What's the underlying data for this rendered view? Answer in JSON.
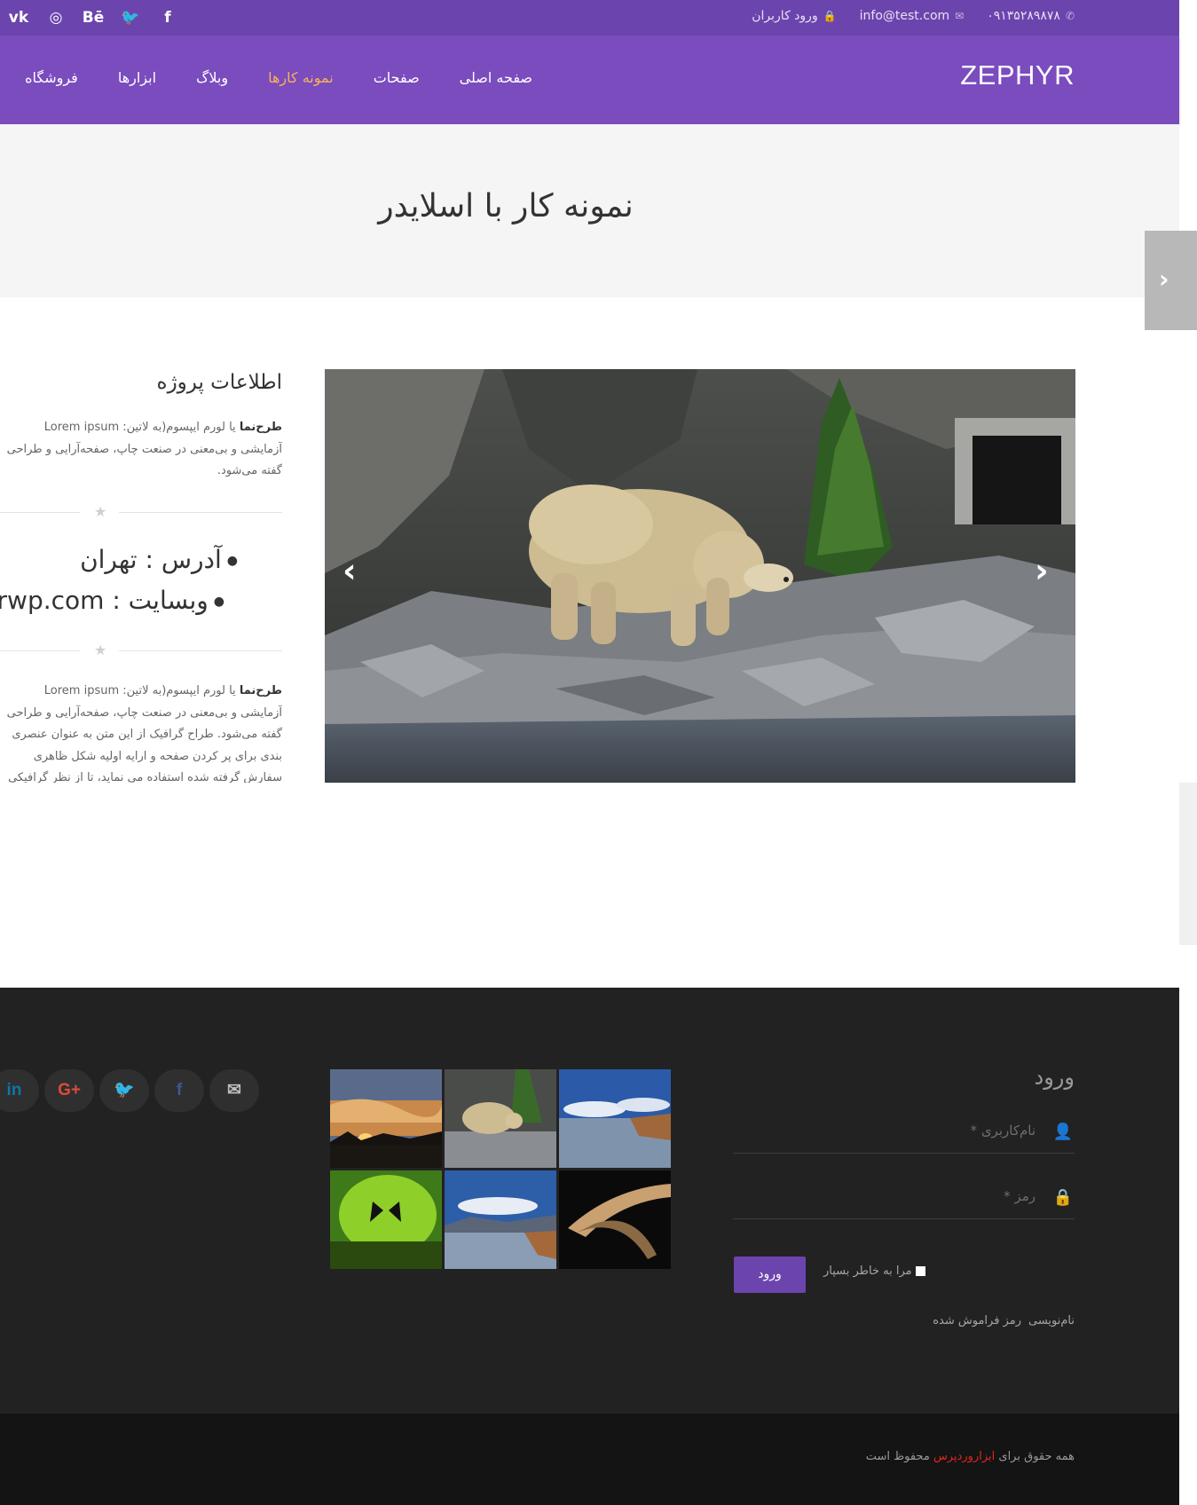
{
  "topbar": {
    "social": [
      "vk",
      "instagram",
      "behance",
      "twitter",
      "facebook"
    ],
    "social_glyphs": {
      "vk": "vk",
      "instagram": "◎",
      "behance": "Bē",
      "twitter": "🐦",
      "facebook": "f"
    },
    "phone": "۰۹۱۳۵۲۸۹۸۷۸",
    "email": "info@test.com",
    "login": "ورود کاربران"
  },
  "nav": {
    "brand": "ZEPHYR",
    "items": [
      "صفحه اصلی",
      "صفحات",
      "نمونه کارها",
      "وبلاگ",
      "ابزارها",
      "فروشگاه"
    ],
    "active_index": 2,
    "active_color": "#f7b35a"
  },
  "page": {
    "title": "نمونه کار با اسلایدر"
  },
  "project": {
    "heading": "اطلاعات پروژه",
    "intro_bold": "طرح‌نما",
    "intro_lines": [
      "یا لورم ایپسوم(به لاتین: Lorem ipsum",
      "آزمایشی و بی‌معنی در صنعت چاپ، صفحه‌آرایی و طراحی",
      "گفته می‌شود."
    ],
    "address": "آدرس : تهران",
    "website": "وبسایت : zarwp.com",
    "body_bold": "طرح‌نما",
    "body_lines": [
      "یا لورم ایپسوم(به لاتین: Lorem ipsum",
      "آزمایشی و بی‌معنی در صنعت چاپ، صفحه‌آرایی و طراحی",
      "گفته می‌شود. طراح گرافیک از این متن به عنوان عنصری",
      "بندی برای پر کردن صفحه و ارایه اولیه شکل ظاهری",
      "سفارش گرفته شده استفاده می نماید، تا از نظر گرافیکی"
    ]
  },
  "login": {
    "title": "ورود",
    "username_placeholder": "نام‌کاربری *",
    "password_placeholder": "رمز *",
    "remember": "مرا به خاطر بسپار",
    "button": "ورود",
    "register": "نام‌نویسی",
    "forgot": "رمز فراموش شده"
  },
  "footer_social": [
    {
      "name": "linkedin",
      "glyph": "in",
      "color": "#0e76a8"
    },
    {
      "name": "google-plus",
      "glyph": "G+",
      "color": "#dd4b39"
    },
    {
      "name": "twitter",
      "glyph": "🐦",
      "color": "#1da1f2"
    },
    {
      "name": "facebook",
      "glyph": "f",
      "color": "#3b5998"
    },
    {
      "name": "email",
      "glyph": "✉",
      "color": "#bdbdbd"
    }
  ],
  "copyright": {
    "prefix": "همه حقوق برای",
    "brand": "ابزاروردپرس",
    "suffix": "محفوظ است"
  },
  "colors": {
    "topbar": "#6b45ad",
    "nav": "#7a4cbe",
    "footer": "#222222",
    "accent": "#6b45ad"
  }
}
